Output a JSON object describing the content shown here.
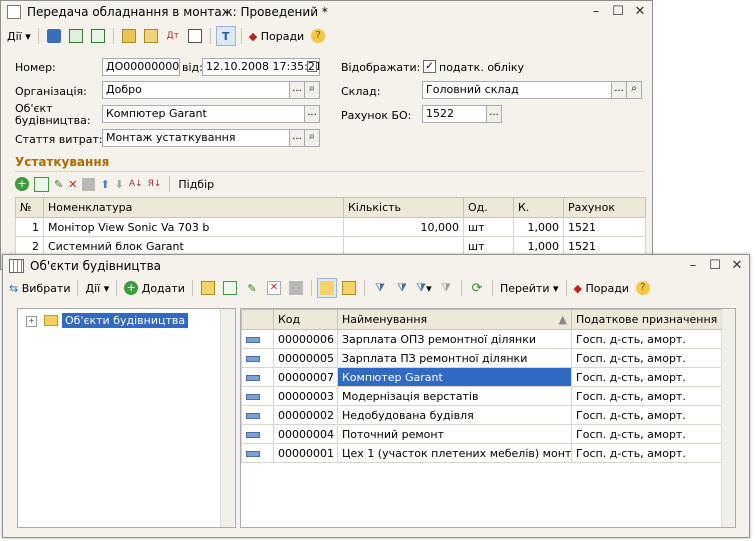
{
  "doc": {
    "title": "Передача обладнання в монтаж: Проведений *",
    "toolbar": {
      "actions_label": "Дії",
      "help_label": "Поради"
    },
    "form": {
      "number_label": "Номер:",
      "number_value": "ДО000000001",
      "date_label": "від:",
      "date_value": "12.10.2008 17:35:21",
      "org_label": "Організація:",
      "org_value": "Добро",
      "object_label": "Об'єкт будівництва:",
      "object_value": "Компютер Garant",
      "cost_label": "Стаття витрат:",
      "cost_value": "Монтаж устаткування",
      "display_label": "Відображати:",
      "tax_label": "податк. обліку",
      "warehouse_label": "Склад:",
      "warehouse_value": "Головний склад",
      "account_label": "Рахунок БО:",
      "account_value": "1522"
    },
    "section_title": "Устаткування",
    "pick_label": "Підбір",
    "table": {
      "headers": [
        "№",
        "Номенклатура",
        "Кількість",
        "Од.",
        "К.",
        "Рахунок"
      ],
      "rows": [
        {
          "n": "1",
          "name": "Монітор View Sonic Va 703 b",
          "qty": "10,000",
          "unit": "шт",
          "k": "1,000",
          "acc": "1521"
        },
        {
          "n": "2",
          "name": "Системний блок Garant",
          "qty": "",
          "unit": "шт",
          "k": "1,000",
          "acc": "1521"
        }
      ]
    }
  },
  "picker": {
    "title": "Об'єкти будівництва",
    "toolbar": {
      "select_label": "Вибрати",
      "actions_label": "Дії",
      "add_label": "Додати",
      "goto_label": "Перейти",
      "help_label": "Поради"
    },
    "tree_root": "Об'єкти будівництва",
    "table": {
      "headers": [
        "Код",
        "Найменування",
        "Податкове призначення"
      ],
      "rows": [
        {
          "code": "00000006",
          "name": "Зарплата ОПЗ ремонтної ділянки",
          "tax": "Госп. д-сть, аморт."
        },
        {
          "code": "00000005",
          "name": "Зарплата ПЗ ремонтної ділянки",
          "tax": "Госп. д-сть, аморт."
        },
        {
          "code": "00000007",
          "name": "Компютер Garant",
          "tax": "Госп. д-сть, аморт."
        },
        {
          "code": "00000003",
          "name": "Модернізація верстатів",
          "tax": "Госп. д-сть, аморт."
        },
        {
          "code": "00000002",
          "name": "Недобудована будівля",
          "tax": "Госп. д-сть, аморт."
        },
        {
          "code": "00000004",
          "name": "Поточний ремонт",
          "tax": "Госп. д-сть, аморт."
        },
        {
          "code": "00000001",
          "name": "Цех 1 (участок плетених мебелів) монтаж в...",
          "tax": "Госп. д-сть, аморт."
        }
      ]
    }
  }
}
